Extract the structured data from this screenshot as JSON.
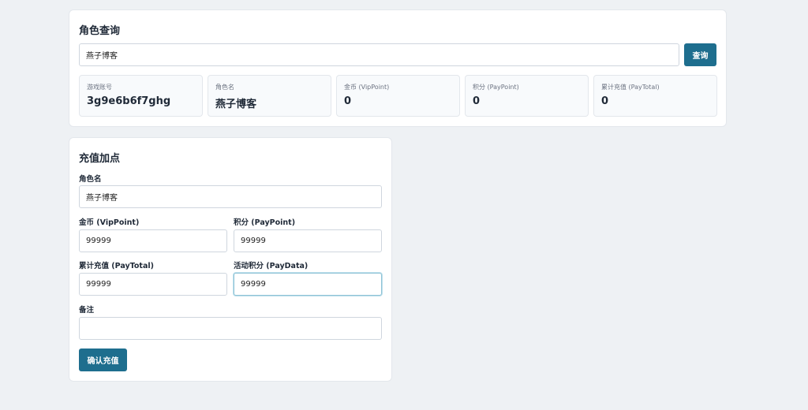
{
  "query": {
    "title": "角色查询",
    "search_value": "燕子博客",
    "search_button": "查询",
    "stats": [
      {
        "label": "游戏账号",
        "value": "3g9e6b6f7ghg"
      },
      {
        "label": "角色名",
        "value": "燕子博客"
      },
      {
        "label": "金币 (VipPoint)",
        "value": "0"
      },
      {
        "label": "积分 (PayPoint)",
        "value": "0"
      },
      {
        "label": "累计充值 (PayTotal)",
        "value": "0"
      }
    ]
  },
  "recharge": {
    "title": "充值加点",
    "role_name_label": "角色名",
    "role_name_value": "燕子博客",
    "vip_point_label": "金币 (VipPoint)",
    "vip_point_value": "99999",
    "pay_point_label": "积分 (PayPoint)",
    "pay_point_value": "99999",
    "pay_total_label": "累计充值 (PayTotal)",
    "pay_total_value": "99999",
    "pay_data_label": "活动积分 (PayData)",
    "pay_data_value": "99999",
    "remark_label": "备注",
    "remark_value": "",
    "confirm_button": "确认充值"
  },
  "colors": {
    "primary": "#1e6e8e",
    "background": "#eef1f4"
  }
}
